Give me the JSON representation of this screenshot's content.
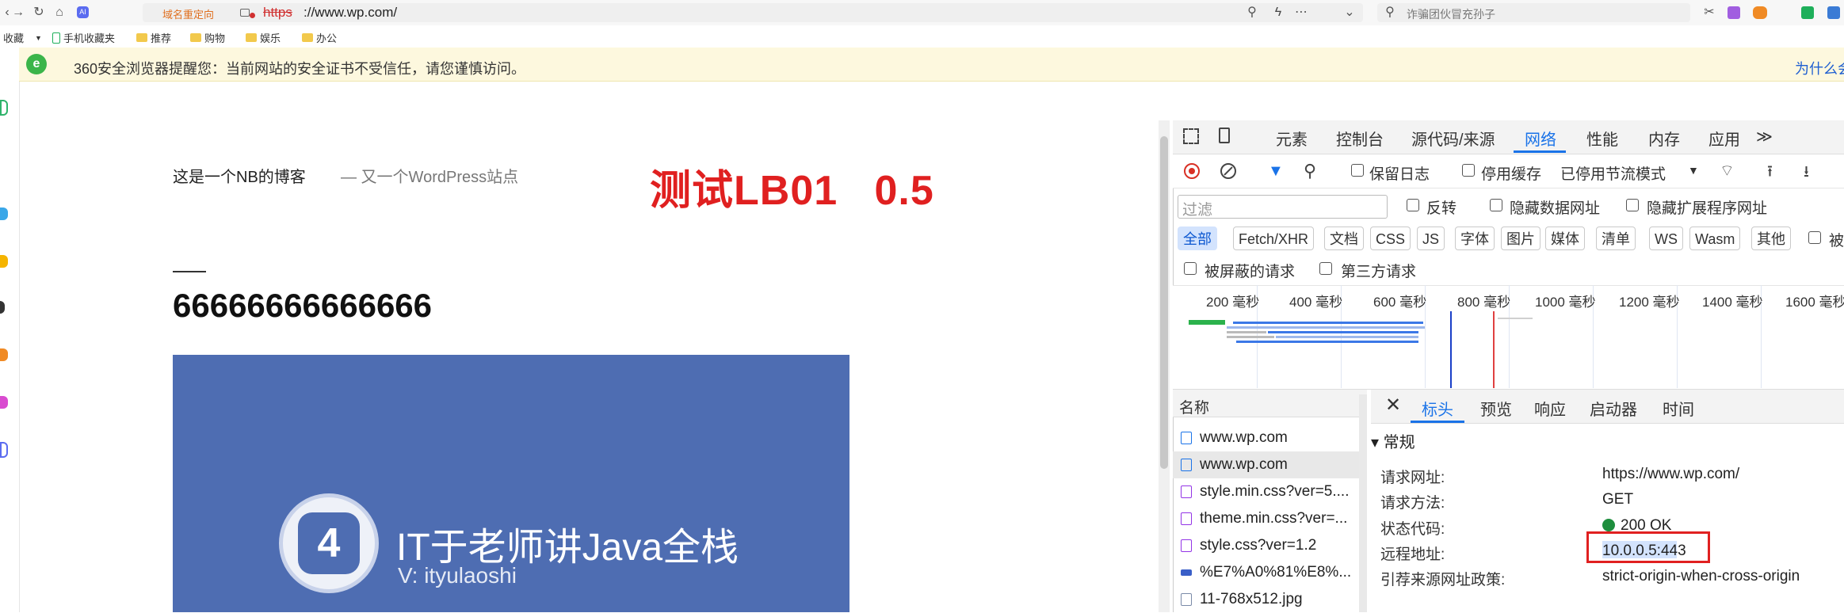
{
  "browser": {
    "redirect_label": "域名重定向",
    "url_scheme": "https",
    "url_rest": "://www.wp.com/",
    "search_placeholder": "诈骗团伙冒充孙子"
  },
  "bookmarks": [
    {
      "label": "收藏",
      "icon": "star-icon"
    },
    {
      "label": "手机收藏夹",
      "icon": "phone-icon"
    },
    {
      "label": "推荐",
      "icon": "folder-icon"
    },
    {
      "label": "购物",
      "icon": "folder-icon"
    },
    {
      "label": "娱乐",
      "icon": "folder-icon"
    },
    {
      "label": "办公",
      "icon": "folder-icon"
    }
  ],
  "warning": {
    "text": "360安全浏览器提醒您：当前网站的安全证书不受信任，请您谨慎访问。",
    "link": "为什么会"
  },
  "page": {
    "site_title": "这是一个NB的博客",
    "site_desc": "—  又一个WordPress站点",
    "test_label": "测试LB01   0.5",
    "post_title": "66666666666666",
    "banner_title": "IT于老师讲Java全栈",
    "banner_sub": "V: ityulaoshi",
    "banner_logo_glyph": "4"
  },
  "devtools": {
    "tabs": [
      "元素",
      "控制台",
      "源代码/来源",
      "网络",
      "性能",
      "内存",
      "应用"
    ],
    "active_tab": "网络",
    "more_tabs": "≫",
    "toolbar": {
      "preserve_log": "保留日志",
      "disable_cache": "停用缓存",
      "throttle": "已停用节流模式"
    },
    "filter_placeholder": "过滤",
    "invert": "反转",
    "hide_data_urls": "隐藏数据网址",
    "hide_ext_urls": "隐藏扩展程序网址",
    "type_chips": [
      "全部",
      "Fetch/XHR",
      "文档",
      "CSS",
      "JS",
      "字体",
      "图片",
      "媒体",
      "清单",
      "WS",
      "Wasm",
      "其他"
    ],
    "blocked_cookie_partial": "被",
    "blocked_requests": "被屏蔽的请求",
    "third_party": "第三方请求",
    "timeline_labels": [
      "200 毫秒",
      "400 毫秒",
      "600 毫秒",
      "800 毫秒",
      "1000 毫秒",
      "1200 毫秒",
      "1400 毫秒",
      "1600 毫秒"
    ],
    "request_list_header": "名称",
    "requests": [
      {
        "name": "www.wp.com",
        "type": "doc",
        "color": "#1a73e8"
      },
      {
        "name": "www.wp.com",
        "type": "doc",
        "color": "#1a73e8"
      },
      {
        "name": "style.min.css?ver=5....",
        "type": "css",
        "color": "#9334e6"
      },
      {
        "name": "theme.min.css?ver=...",
        "type": "css",
        "color": "#9334e6"
      },
      {
        "name": "style.css?ver=1.2",
        "type": "css",
        "color": "#9334e6"
      },
      {
        "name": "%E7%A0%81%E8%...",
        "type": "img",
        "color": "#3a5fc8"
      },
      {
        "name": "11-768x512.jpg",
        "type": "img",
        "color": "#3a5fc8"
      }
    ],
    "detail_tabs": [
      "标头",
      "预览",
      "响应",
      "启动器",
      "时间"
    ],
    "active_detail_tab": "标头",
    "general_header": "▾ 常规",
    "general": [
      {
        "key": "请求网址:",
        "value": "https://www.wp.com/"
      },
      {
        "key": "请求方法:",
        "value": "GET"
      },
      {
        "key": "状态代码:",
        "value": "200 OK"
      },
      {
        "key": "远程地址:",
        "value": "10.0.0.5:443"
      },
      {
        "key": "引荐来源网址政策:",
        "value": "strict-origin-when-cross-origin"
      }
    ],
    "colors": {
      "accent": "#1a73e8",
      "record": "#d93025",
      "highlight": "#e02020"
    }
  }
}
